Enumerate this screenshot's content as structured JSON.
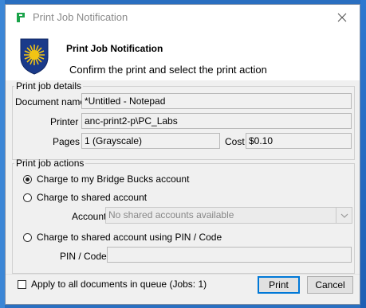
{
  "window": {
    "title": "Print Job Notification"
  },
  "header": {
    "title": "Print Job Notification",
    "subtitle": "Confirm the print and select the print action"
  },
  "details": {
    "legend": "Print job details",
    "document_label": "Document name",
    "document_value": "*Untitled - Notepad",
    "printer_label": "Printer",
    "printer_value": "anc-print2-p\\PC_Labs",
    "pages_label": "Pages",
    "pages_value": "1   (Grayscale)",
    "cost_label": "Cost",
    "cost_value": "$0.10"
  },
  "actions": {
    "legend": "Print job actions",
    "option_bridge": "Charge to my Bridge Bucks account",
    "option_shared": "Charge to shared account",
    "account_label": "Account",
    "account_placeholder": "No shared accounts available",
    "option_pin": "Charge to shared account using PIN / Code",
    "pin_label": "PIN / Code",
    "pin_value": "",
    "selected": "bridge"
  },
  "footer": {
    "apply_all_label": "Apply to all documents in queue (Jobs: 1)",
    "print_label": "Print",
    "cancel_label": "Cancel"
  },
  "icons": {
    "app": "print-app-icon",
    "close": "close-icon",
    "crest": "university-crest-icon",
    "dropdown": "chevron-down-icon"
  },
  "colors": {
    "accent": "#0078d7",
    "crest_blue": "#1a3a8a",
    "crest_gold": "#f2c414",
    "app_icon_green": "#1aa34a"
  }
}
